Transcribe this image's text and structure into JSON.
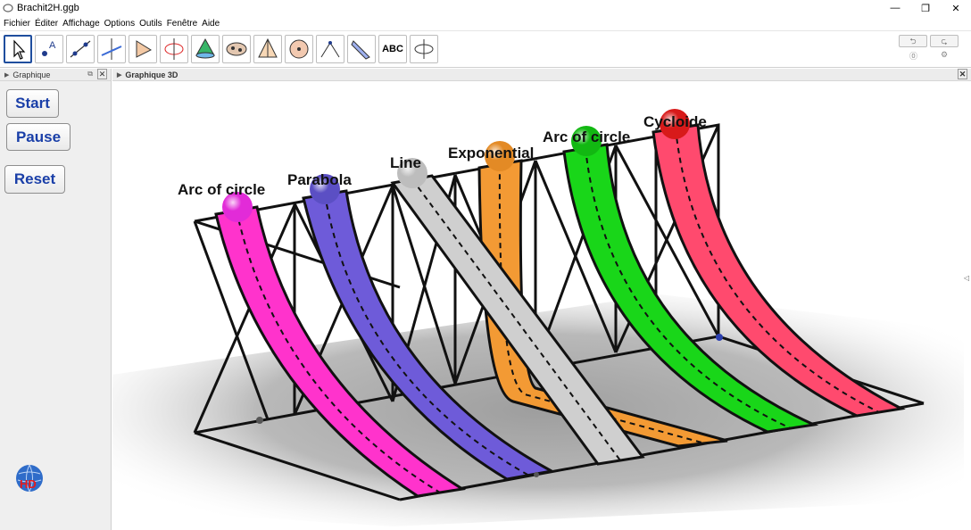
{
  "window": {
    "title": "Brachit2H.ggb",
    "controls": {
      "minimize": "—",
      "maximize": "❐",
      "close": "✕"
    }
  },
  "menu": [
    "Fichier",
    "Éditer",
    "Affichage",
    "Options",
    "Outils",
    "Fenêtre",
    "Aide"
  ],
  "toolbar": {
    "tools": [
      {
        "name": "move-tool",
        "selected": true
      },
      {
        "name": "point-tool"
      },
      {
        "name": "line-tool"
      },
      {
        "name": "perpendicular-tool"
      },
      {
        "name": "polygon-tool"
      },
      {
        "name": "circle-tool"
      },
      {
        "name": "cone-tool"
      },
      {
        "name": "net-tool"
      },
      {
        "name": "pyramid-tool"
      },
      {
        "name": "sphere-tool"
      },
      {
        "name": "angle-tool"
      },
      {
        "name": "reflect-tool"
      },
      {
        "name": "text-tool"
      },
      {
        "name": "rotate-view-tool"
      }
    ],
    "text_tool_label": "ABC"
  },
  "left_panel": {
    "title": "Graphique",
    "buttons": {
      "start": "Start",
      "pause": "Pause",
      "reset": "Reset"
    }
  },
  "graphics3d": {
    "title": "Graphique 3D",
    "curves": [
      {
        "label": "Arc of circle",
        "color": "#ff33cc",
        "ball": "#e22bd8"
      },
      {
        "label": "Parabola",
        "color": "#6e5bd9",
        "ball": "#5b4fc4"
      },
      {
        "label": "Line",
        "color": "#cfcfcf",
        "ball": "#bdbdbd"
      },
      {
        "label": "Exponential",
        "color": "#f39a34",
        "ball": "#e38a25"
      },
      {
        "label": "Arc of circle",
        "color": "#19d619",
        "ball": "#12b812"
      },
      {
        "label": "Cycloide",
        "color": "#ff4a6e",
        "ball": "#d81a1a"
      }
    ]
  },
  "colors": {
    "button_text": "#1a3fa8",
    "selected_tool_border": "#1f4e9e"
  }
}
